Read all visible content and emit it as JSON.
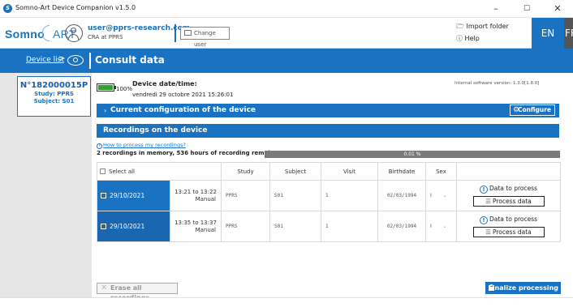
{
  "window": {
    "title": "Somno-Art Device Companion v1.5.0",
    "minimize": "–",
    "maximize": "☐",
    "close": "✕"
  },
  "header": {
    "logo_somno": "Somno",
    "logo_art": "ART",
    "user_email": "user@pprs-research.com",
    "user_role": "CRA at PPRS",
    "change_user_label": "Change user",
    "import_folder_label": "Import folder",
    "help_label": "Help",
    "lang_en": "EN",
    "lang_fr": "FR"
  },
  "breadcrumb": {
    "device_list_label": "Device list",
    "separator": ">",
    "page_title": "Consult data"
  },
  "device": {
    "id": "N°182000015P",
    "study": "Study: PPRS",
    "subject": "Subject: S01",
    "battery_percent": "100%",
    "battery_level": 1.0,
    "datetime_label": "Device date/time:",
    "datetime_value": "vendredi 29 octobre 2021 15:26:01",
    "firmware": "Internal software version: 1.3.0[1.8.0]"
  },
  "config_section": {
    "arrow": "›",
    "title": "Current configuration of the device",
    "configure_label": "Configure"
  },
  "recordings": {
    "section_title": "Recordings on the device",
    "how_to_link": "How to process my recordings?",
    "memory_info": "2 recordings in memory, 536 hours of recording remain",
    "memory_used_text": "0.01 %",
    "memory_used_fraction": 0.0001,
    "columns": {
      "select_all": "Select all",
      "study": "Study",
      "subject": "Subject",
      "visit": "Visit",
      "birthdate": "Birthdate",
      "sex": "Sex"
    },
    "rows": [
      {
        "date": "29/10/2021",
        "time_range": "13:21 to 13:22",
        "mode": "Manual",
        "study": "PPRS",
        "subject": "S01",
        "visit": "1",
        "birthdate": "02/03/1994",
        "sex": "I",
        "status": "Data to process",
        "action": "Process data"
      },
      {
        "date": "29/10/2021",
        "time_range": "13:35 to 13:37",
        "mode": "Manual",
        "study": "PPRS",
        "subject": "S01",
        "visit": "1",
        "birthdate": "02/03/1994",
        "sex": "I",
        "status": "Data to process",
        "action": "Process data"
      }
    ],
    "erase_all_label": "Erase all recordings",
    "finalize_label": "Finalize processing"
  }
}
